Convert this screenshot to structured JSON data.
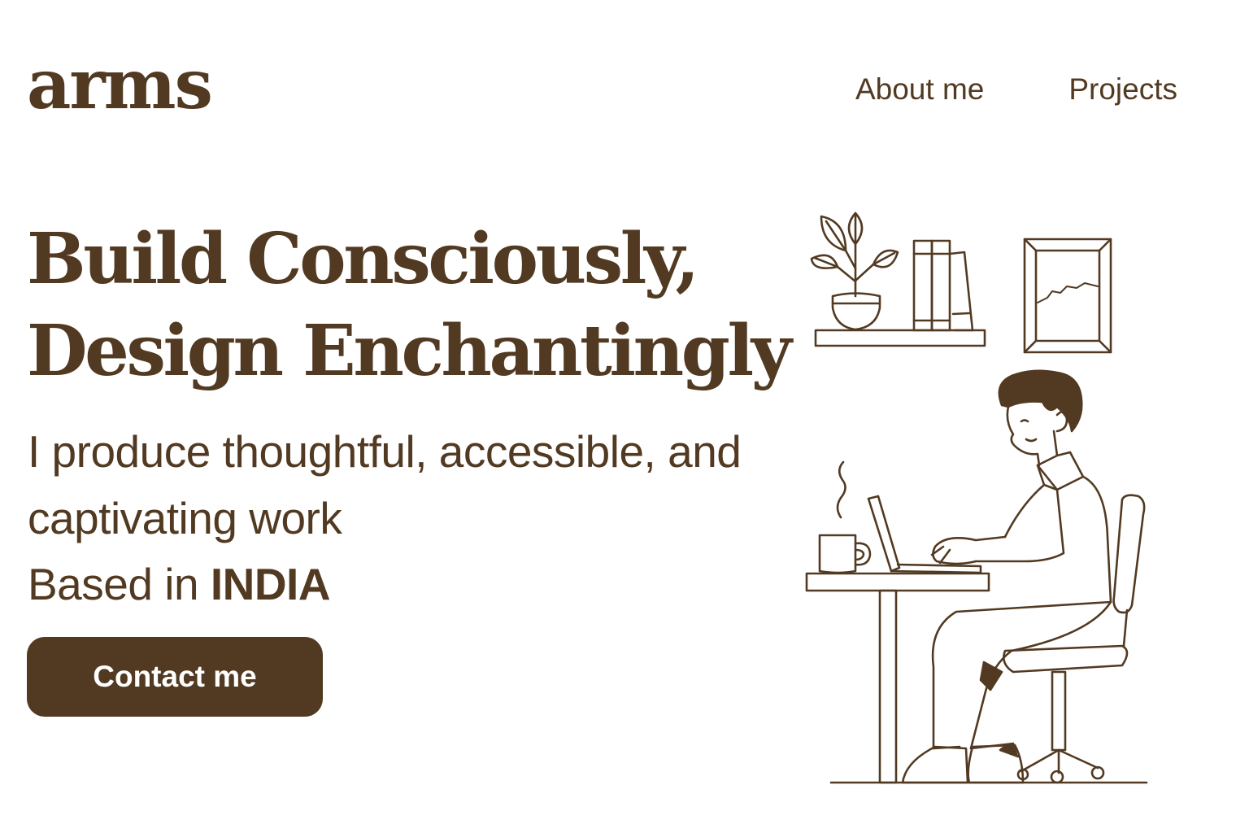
{
  "header": {
    "logo": "arms",
    "nav": [
      {
        "label": "About me"
      },
      {
        "label": "Projects"
      }
    ]
  },
  "hero": {
    "headline_line1": "Build Consciously,",
    "headline_line2": "Design Enchantingly",
    "subtitle": "I produce thoughtful, accessible, and captivating work",
    "location_prefix": "Based in",
    "location_country": "INDIA",
    "cta_label": "Contact me"
  },
  "colors": {
    "brand": "#523a22",
    "background": "#ffffff",
    "button_text": "#ffffff"
  },
  "illustration": {
    "subject": "person-working-at-desk-illustration",
    "icons": [
      "plant-icon",
      "books-icon",
      "picture-frame-icon",
      "coffee-mug-icon",
      "laptop-icon",
      "desk-icon",
      "office-chair-icon",
      "person-icon"
    ]
  }
}
